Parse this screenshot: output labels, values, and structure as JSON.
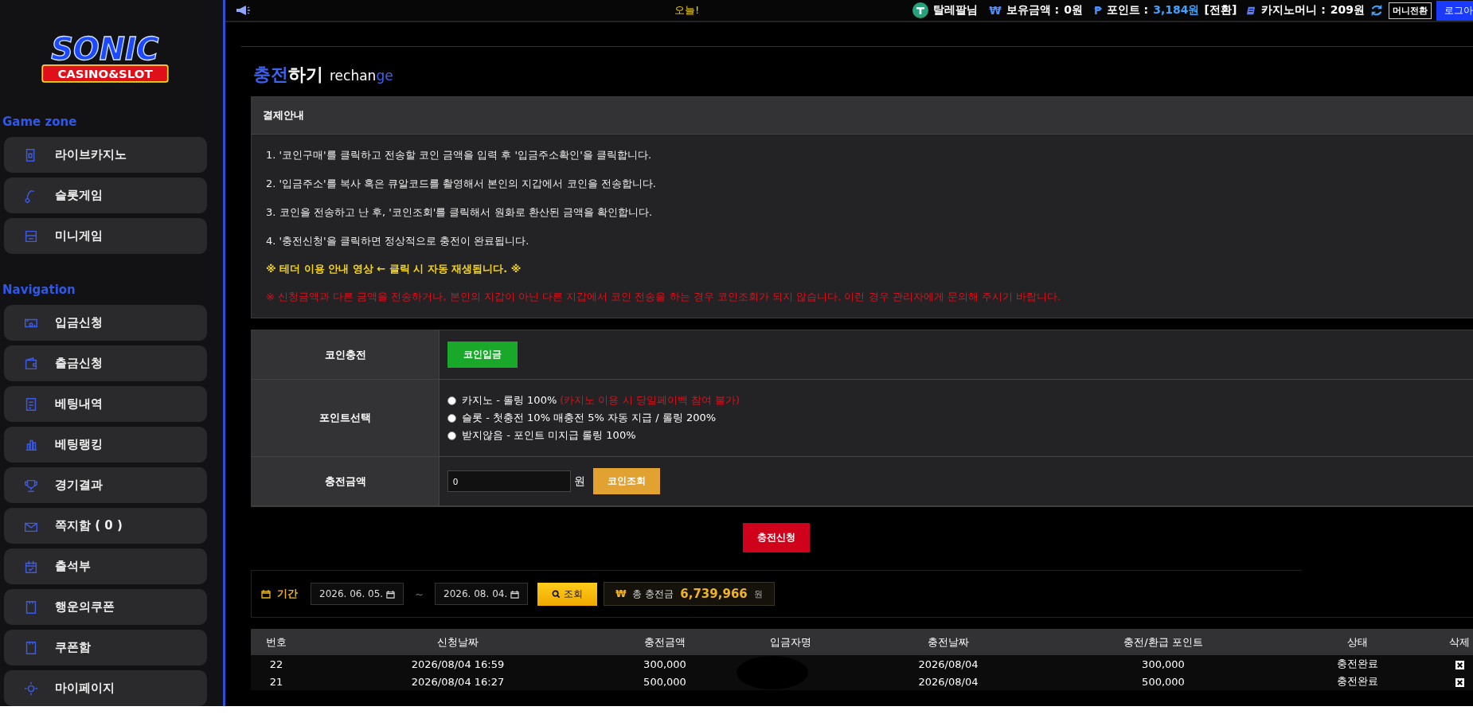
{
  "logo": {
    "title": "SONIC",
    "subtitle": "CASINO&SLOT"
  },
  "sidebar": {
    "sections": [
      {
        "heading": "Game zone",
        "items": [
          {
            "label": "라이브카지노"
          },
          {
            "label": "슬롯게임"
          },
          {
            "label": "미니게임"
          }
        ]
      },
      {
        "heading": "Navigation",
        "items": [
          {
            "label": "입금신청"
          },
          {
            "label": "출금신청"
          },
          {
            "label": "베팅내역"
          },
          {
            "label": "베팅랭킹"
          },
          {
            "label": "경기결과"
          },
          {
            "label": "쪽지함 ( 0 )"
          },
          {
            "label": "출석부"
          },
          {
            "label": "행운의쿠폰"
          },
          {
            "label": "쿠폰함"
          },
          {
            "label": "마이페이지"
          }
        ]
      }
    ]
  },
  "top_bar": {
    "notice": "오늘!",
    "user": "탈레팔님",
    "balances": [
      {
        "symbol": "₩",
        "label": "보유금액 :",
        "value": "0",
        "unit": "원"
      },
      {
        "symbol": "₱",
        "label": "포인트 :",
        "value": "3,184",
        "unit": "원",
        "link": "[전환]"
      }
    ],
    "casino_money": {
      "label": "카지노머니 :",
      "value": "209",
      "unit": "원"
    },
    "buttons": [
      "머니전환",
      "로그아"
    ]
  },
  "page_title": {
    "parts": [
      {
        "text": "충전",
        "accent": true
      },
      {
        "text": "하기",
        "accent": false
      }
    ],
    "subtitle_parts": [
      {
        "text": "rechan",
        "accent": false
      },
      {
        "text": "ge",
        "accent": true
      }
    ]
  },
  "info_box": {
    "title": "결제안내",
    "lines": [
      {
        "kind": "step",
        "text": "1. '코인구매'를 클릭하고 전송할 코인 금액을 입력 후 '입금주소확인'을 클릭합니다."
      },
      {
        "kind": "step",
        "text": "2. '입금주소'를 복사 혹은 큐알코드를 촬영해서 본인의 지갑에서 코인을 전송합니다."
      },
      {
        "kind": "step",
        "text": "3. 코인을 전송하고 난 후, '코인조회'를 클릭해서 원화로 환산된 금액을 확인합니다."
      },
      {
        "kind": "step",
        "text": "4. '충전신청'을 클릭하면 정상적으로 충전이 완료됩니다."
      },
      {
        "kind": "highlight",
        "text": "※ 테더 이용 안내 영상 ← 클릭 시 자동 재생됩니다. ※"
      },
      {
        "kind": "warning",
        "text": "※ 신청금액과 다른 금액을 전송하거나, 본인의 지갑이 아닌 다른 지갑에서 코인 전송을 하는 경우 코인조회가 되지 않습니다. 이런 경우 관리자에게 문의해 주시기 바랍니다."
      }
    ]
  },
  "form": {
    "coin_row": {
      "label": "코인충전",
      "button": "코인입금"
    },
    "point_row": {
      "label": "포인트선택",
      "options": [
        {
          "label": "카지노 - 롤링 100%",
          "note": "(카지노 이용 시 당일페이백 참여 불가)",
          "selected": false
        },
        {
          "label": "슬롯 - 첫충전 10% 매충전 5% 자동 지급 / 롤링 200%",
          "selected": false
        },
        {
          "label": "받지않음 - 포인트 미지급 롤링 100%",
          "selected": false
        }
      ]
    },
    "amount_row": {
      "label": "충전금액",
      "value": "0",
      "unit": "원",
      "button": "코인조회"
    },
    "submit": "충전신청"
  },
  "filter": {
    "label": "기간",
    "from": "2026. 06. 05.",
    "separator": "~",
    "to": "2026. 08. 04.",
    "search": "조회",
    "total_symbol": "₩",
    "total_label": "총 충전금",
    "total_value": "6,739,966",
    "total_unit": "원"
  },
  "table": {
    "columns": [
      "번호",
      "신청날짜",
      "충전금액",
      "입금자명",
      "충전날짜",
      "충전/환급 포인트",
      "상태",
      "삭제"
    ],
    "rows": [
      {
        "no": "22",
        "requested": "2026/08/04 16:59",
        "amount": "300,000",
        "charged": "2026/08/04",
        "points": "300,000",
        "status": "충전완료"
      },
      {
        "no": "21",
        "requested": "2026/08/04 16:27",
        "amount": "500,000",
        "charged": "2026/08/04",
        "points": "500,000",
        "status": "충전완료"
      }
    ]
  }
}
